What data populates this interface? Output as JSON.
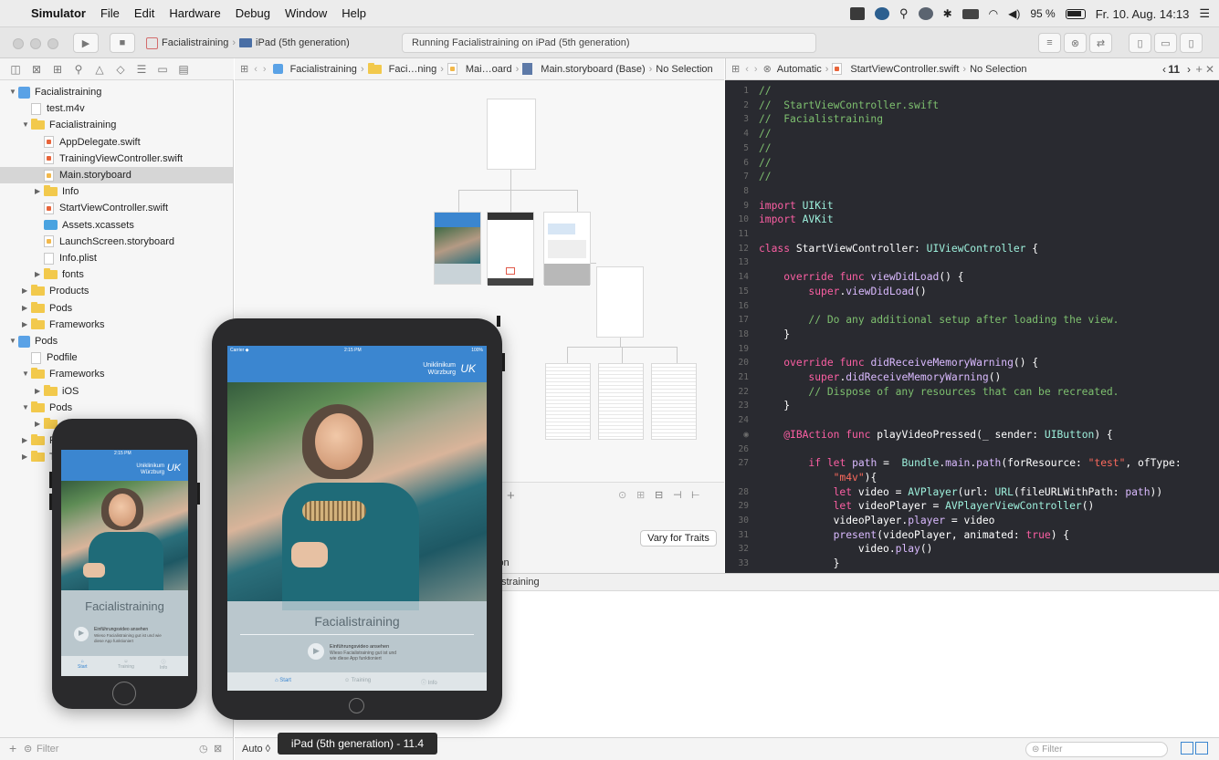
{
  "menubar": {
    "app_name": "Simulator",
    "items": [
      "File",
      "Edit",
      "Hardware",
      "Debug",
      "Window",
      "Help"
    ],
    "battery": "95 %",
    "datetime": "Fr. 10. Aug. 14:13"
  },
  "toolbar": {
    "scheme_name": "Facialistraining",
    "destination": "iPad (5th generation)",
    "activity": "Running Facialistraining on iPad (5th generation)"
  },
  "navigator": {
    "filter_placeholder": "Filter",
    "items": [
      {
        "label": "Facialistraining",
        "kind": "project",
        "indent": 0,
        "disclosure": "open"
      },
      {
        "label": "test.m4v",
        "kind": "file",
        "indent": 1,
        "disclosure": ""
      },
      {
        "label": "Facialistraining",
        "kind": "folder",
        "indent": 1,
        "disclosure": "open"
      },
      {
        "label": "AppDelegate.swift",
        "kind": "swift",
        "indent": 2,
        "disclosure": ""
      },
      {
        "label": "TrainingViewController.swift",
        "kind": "swift",
        "indent": 2,
        "disclosure": ""
      },
      {
        "label": "Main.storyboard",
        "kind": "storyboard",
        "indent": 2,
        "disclosure": "",
        "selected": true
      },
      {
        "label": "Info",
        "kind": "folder",
        "indent": 2,
        "disclosure": "closed"
      },
      {
        "label": "StartViewController.swift",
        "kind": "swift",
        "indent": 2,
        "disclosure": ""
      },
      {
        "label": "Assets.xcassets",
        "kind": "assets",
        "indent": 2,
        "disclosure": ""
      },
      {
        "label": "LaunchScreen.storyboard",
        "kind": "storyboard",
        "indent": 2,
        "disclosure": ""
      },
      {
        "label": "Info.plist",
        "kind": "file",
        "indent": 2,
        "disclosure": ""
      },
      {
        "label": "fonts",
        "kind": "folder",
        "indent": 2,
        "disclosure": "closed"
      },
      {
        "label": "Products",
        "kind": "folder",
        "indent": 1,
        "disclosure": "closed"
      },
      {
        "label": "Pods",
        "kind": "folder",
        "indent": 1,
        "disclosure": "closed"
      },
      {
        "label": "Frameworks",
        "kind": "folder",
        "indent": 1,
        "disclosure": "closed"
      },
      {
        "label": "Pods",
        "kind": "project",
        "indent": 0,
        "disclosure": "open"
      },
      {
        "label": "Podfile",
        "kind": "file",
        "indent": 1,
        "disclosure": ""
      },
      {
        "label": "Frameworks",
        "kind": "folder",
        "indent": 1,
        "disclosure": "open"
      },
      {
        "label": "iOS",
        "kind": "folder",
        "indent": 2,
        "disclosure": "closed"
      },
      {
        "label": "Pods",
        "kind": "folder",
        "indent": 1,
        "disclosure": "open"
      },
      {
        "label": "",
        "kind": "folder",
        "indent": 2,
        "disclosure": "closed"
      },
      {
        "label": "P",
        "kind": "folder",
        "indent": 1,
        "disclosure": "closed"
      },
      {
        "label": "T",
        "kind": "folder",
        "indent": 1,
        "disclosure": "closed"
      }
    ]
  },
  "ib_jumpbar": {
    "crumbs": [
      "Facialistraining",
      "Faci…ning",
      "Mai…oard",
      "Main.storyboard (Base)",
      "No Selection"
    ]
  },
  "code_jumpbar": {
    "crumbs": [
      "Automatic",
      "StartViewController.swift",
      "No Selection"
    ],
    "counter": "11"
  },
  "canvas": {
    "vary_button": "Vary for Traits",
    "partial_label": "ion",
    "zoom_label": "Auto ◊"
  },
  "debug_area": {
    "partial_label": "straining",
    "filter_placeholder": "Filter"
  },
  "code": {
    "lines": [
      {
        "n": "1",
        "text": "//"
      },
      {
        "n": "2",
        "text": "//  StartViewController.swift"
      },
      {
        "n": "3",
        "text": "//  Facialistraining"
      },
      {
        "n": "4",
        "text": "//"
      },
      {
        "n": "5",
        "text": "//"
      },
      {
        "n": "6",
        "text": "//"
      },
      {
        "n": "7",
        "text": "//"
      },
      {
        "n": "8",
        "text": ""
      },
      {
        "n": "9",
        "text": "import UIKit"
      },
      {
        "n": "10",
        "text": "import AVKit"
      },
      {
        "n": "11",
        "text": ""
      },
      {
        "n": "12",
        "text": "class StartViewController: UIViewController {"
      },
      {
        "n": "13",
        "text": ""
      },
      {
        "n": "14",
        "text": "    override func viewDidLoad() {"
      },
      {
        "n": "15",
        "text": "        super.viewDidLoad()"
      },
      {
        "n": "16",
        "text": ""
      },
      {
        "n": "17",
        "text": "        // Do any additional setup after loading the view."
      },
      {
        "n": "18",
        "text": "    }"
      },
      {
        "n": "19",
        "text": ""
      },
      {
        "n": "20",
        "text": "    override func didReceiveMemoryWarning() {"
      },
      {
        "n": "21",
        "text": "        super.didReceiveMemoryWarning()"
      },
      {
        "n": "22",
        "text": "        // Dispose of any resources that can be recreated."
      },
      {
        "n": "23",
        "text": "    }"
      },
      {
        "n": "24",
        "text": ""
      },
      {
        "n": "◉",
        "text": "    @IBAction func playVideoPressed(_ sender: UIButton) {"
      },
      {
        "n": "26",
        "text": ""
      },
      {
        "n": "27",
        "text": "        if let path =  Bundle.main.path(forResource: \"test\", ofType:"
      },
      {
        "n": "",
        "text": "            \"m4v\"){"
      },
      {
        "n": "28",
        "text": "            let video = AVPlayer(url: URL(fileURLWithPath: path))"
      },
      {
        "n": "29",
        "text": "            let videoPlayer = AVPlayerViewController()"
      },
      {
        "n": "30",
        "text": "            videoPlayer.player = video"
      },
      {
        "n": "31",
        "text": "            present(videoPlayer, animated: true) {"
      },
      {
        "n": "32",
        "text": "                video.play()"
      },
      {
        "n": "33",
        "text": "            }"
      }
    ]
  },
  "iphone": {
    "status_time": "2:15 PM",
    "brand_line1": "Uniklinikum",
    "brand_line2": "Würzburg",
    "brand_logo": "UK",
    "app_title": "Facialistraining",
    "video_title": "Einführungsvideo ansehen",
    "video_sub": "Wieso Facialistraining gut ist und wie diese App funktioniert",
    "tabs": [
      "Start",
      "Training",
      "Info"
    ]
  },
  "ipad": {
    "status_carrier": "Carrier ◆",
    "status_time": "2:15 PM",
    "status_battery": "100%",
    "brand_line1": "Uniklinikum",
    "brand_line2": "Würzburg",
    "brand_logo": "UK",
    "app_title": "Facialistraining",
    "video_title": "Einführungsvideo ansehen",
    "video_sub": "Wieso Facialistraining gut ist und wie diese App funktioniert",
    "tabs": [
      "Start",
      "Training",
      "Info"
    ]
  },
  "tooltip": "iPad (5th generation) - 11.4"
}
